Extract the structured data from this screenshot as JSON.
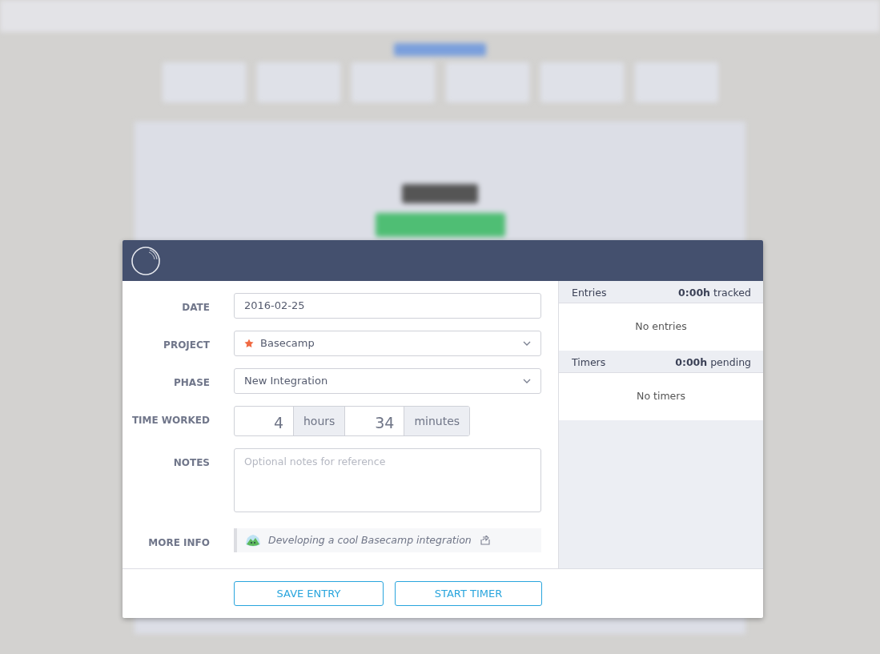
{
  "form": {
    "date": {
      "label": "DATE",
      "value": "2016-02-25"
    },
    "project": {
      "label": "PROJECT",
      "value": "Basecamp",
      "starred": true
    },
    "phase": {
      "label": "PHASE",
      "value": "New Integration"
    },
    "time_worked": {
      "label": "TIME WORKED",
      "hours": "4",
      "hours_unit": "hours",
      "minutes": "34",
      "minutes_unit": "minutes"
    },
    "notes": {
      "label": "NOTES",
      "placeholder": "Optional notes for reference"
    },
    "more_info": {
      "label": "MORE INFO",
      "text": "Developing a cool Basecamp integration"
    }
  },
  "buttons": [
    "SAVE ENTRY",
    "START TIMER"
  ],
  "sidebar": [
    {
      "title": "Entries",
      "summary": "**0:00h** tracked",
      "empty": "No entries"
    },
    {
      "title": "Timers",
      "summary": "**0:00h** pending",
      "empty": "No timers"
    }
  ]
}
